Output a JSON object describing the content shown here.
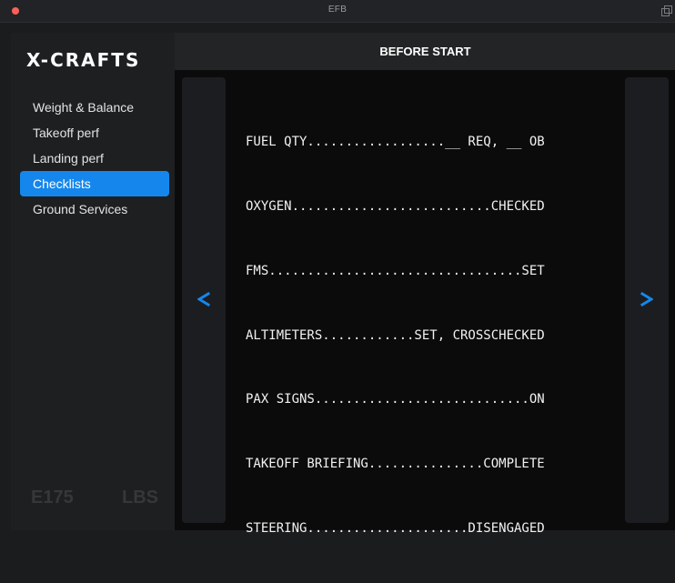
{
  "window": {
    "title": "EFB",
    "icons": [
      "close-dot",
      "popout-icon"
    ]
  },
  "sidebar": {
    "brand": "X-CRAFTS",
    "items": [
      {
        "label": "Weight & Balance",
        "active": false
      },
      {
        "label": "Takeoff perf",
        "active": false
      },
      {
        "label": "Landing perf",
        "active": false
      },
      {
        "label": "Checklists",
        "active": true
      },
      {
        "label": "Ground Services",
        "active": false
      }
    ],
    "aircraft": "E175",
    "unit": "LBS"
  },
  "main": {
    "title": "BEFORE START",
    "prev_icon": "chevron-left-icon",
    "next_icon": "chevron-right-icon",
    "checklist": [
      {
        "text": "FUEL QTY..................__ REQ, __ OB"
      },
      {
        "text": "OXYGEN..........................CHECKED"
      },
      {
        "text": "FMS.................................SET"
      },
      {
        "text": "ALTIMETERS............SET, CROSSCHECKED"
      },
      {
        "text": "PAX SIGNS............................ON"
      },
      {
        "text": "TAKEOFF BRIEFING...............COMPLETE"
      },
      {
        "text": "STEERING.....................DISENGAGED"
      }
    ]
  },
  "colors": {
    "accent": "#1587ec",
    "close": "#ff5f57",
    "background": "#0b0b0c",
    "sidebar": "#1d1f21"
  }
}
